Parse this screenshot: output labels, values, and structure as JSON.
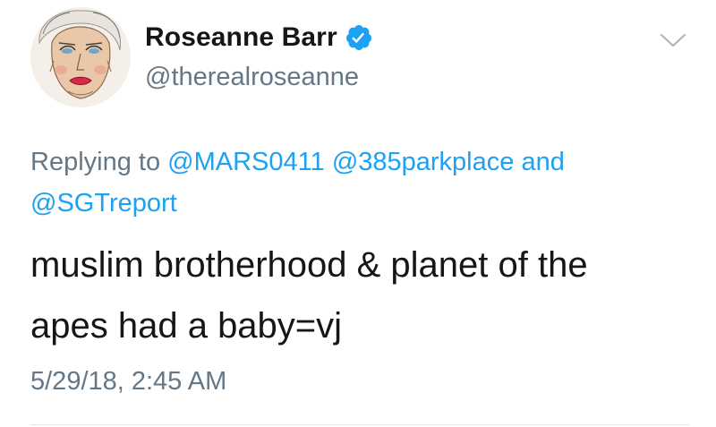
{
  "tweet": {
    "display_name": "Roseanne Barr",
    "handle": "@therealroseanne",
    "verified": true,
    "reply": {
      "prefix": "Replying to",
      "mentions": [
        "@MARS0411",
        "@385parkplace",
        "@SGTreport"
      ],
      "and": "and"
    },
    "text_line1": "muslim brotherhood & planet of the",
    "text_line2": "apes had a baby=vj",
    "timestamp": "5/29/18, 2:45 AM"
  },
  "icons": {
    "verified": "verified-badge-icon",
    "menu": "chevron-down-icon"
  },
  "colors": {
    "accent": "#1da1f2",
    "secondary_text": "#657786",
    "primary_text": "#14171a"
  }
}
